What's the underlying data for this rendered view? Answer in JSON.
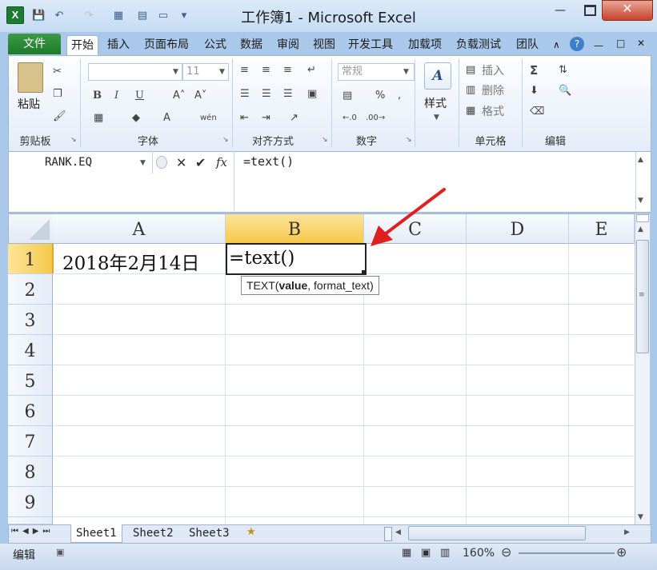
{
  "window": {
    "title": "工作簿1 - Microsoft Excel"
  },
  "quick_access": {
    "icons": [
      "save-icon",
      "undo-icon",
      "redo-icon"
    ]
  },
  "tabs": {
    "file": "文件",
    "items": [
      "开始",
      "插入",
      "页面布局",
      "公式",
      "数据",
      "审阅",
      "视图",
      "开发工具",
      "加载项",
      "负载测试",
      "团队"
    ]
  },
  "ribbon": {
    "paste": "粘贴",
    "font_name": "",
    "font_size": "11",
    "number_format": "常规",
    "styles": "样式",
    "insert": "插入",
    "delete": "删除",
    "format": "格式",
    "groups": {
      "clipboard": "剪贴板",
      "font": "字体",
      "alignment": "对齐方式",
      "number": "数字",
      "cells": "单元格",
      "editing": "编辑"
    }
  },
  "formula_bar": {
    "name_box": "RANK.EQ",
    "formula": "=text()"
  },
  "grid": {
    "columns": [
      "A",
      "B",
      "C",
      "D",
      "E"
    ],
    "rows": [
      "1",
      "2",
      "3",
      "4",
      "5",
      "6",
      "7",
      "8",
      "9"
    ],
    "cell_a1": "2018年2月14日",
    "cell_b1": "=text()",
    "tooltip_fn": "TEXT(",
    "tooltip_arg1": "value",
    "tooltip_rest": ", format_text)"
  },
  "sheets": [
    "Sheet1",
    "Sheet2",
    "Sheet3"
  ],
  "status": {
    "mode": "编辑",
    "zoom": "160%"
  },
  "colors": {
    "accent": "#1f7a2c",
    "ribbon_border": "#9fb5d2",
    "selected_header": "#f9d75b",
    "arrow": "#e02020"
  }
}
